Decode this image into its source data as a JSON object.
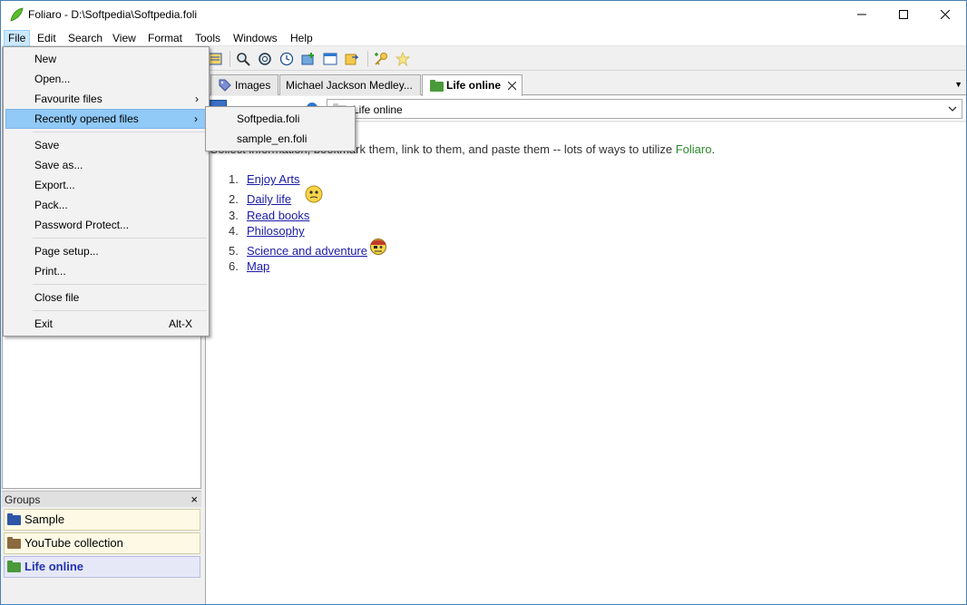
{
  "window": {
    "title": "Foliaro - D:\\Softpedia\\Softpedia.foli",
    "controls": {
      "minimize": "minimize-icon",
      "maximize": "maximize-icon",
      "close": "close-icon"
    }
  },
  "menubar": [
    "File",
    "Edit",
    "Search",
    "View",
    "Format",
    "Tools",
    "Windows",
    "Help"
  ],
  "file_menu": {
    "items": [
      {
        "label": "New"
      },
      {
        "label": "Open..."
      },
      {
        "label": "Favourite files",
        "submenu": true
      },
      {
        "label": "Recently opened files",
        "submenu": true,
        "highlighted": true
      },
      {
        "label": "Save"
      },
      {
        "label": "Save as..."
      },
      {
        "label": "Export..."
      },
      {
        "label": "Pack..."
      },
      {
        "label": "Password Protect..."
      },
      {
        "label": "Page setup..."
      },
      {
        "label": "Print..."
      },
      {
        "label": "Close file"
      },
      {
        "label": "Exit",
        "shortcut": "Alt-X"
      }
    ]
  },
  "recent_submenu": [
    "Softpedia.foli",
    "sample_en.foli"
  ],
  "tabs": [
    {
      "label": "Images",
      "active": false
    },
    {
      "label": "Michael Jackson Medley...",
      "active": false
    },
    {
      "label": "Life online",
      "active": true
    }
  ],
  "address": {
    "value": "Life online"
  },
  "content": {
    "intro": "Collect information, bookmark them, link to them, and paste them -- lots of ways to utilize ",
    "brand": "Foliaro",
    "brand_end": ".",
    "links": [
      {
        "num": "1.",
        "label": "Enjoy Arts"
      },
      {
        "num": "2.",
        "label": "Daily life"
      },
      {
        "num": "3.",
        "label": "Read books"
      },
      {
        "num": "4.",
        "label": "Philosophy"
      },
      {
        "num": "5.",
        "label": "Science and adventure "
      },
      {
        "num": "6.",
        "label": "Map"
      }
    ]
  },
  "groups": {
    "title": "Groups",
    "close": "×",
    "items": [
      {
        "label": "Sample",
        "folder_color": "#2f55a8",
        "selected": false
      },
      {
        "label": "YouTube collection",
        "folder_color": "#8a6a3e",
        "selected": false
      },
      {
        "label": "Life online",
        "folder_color": "#4a9a3a",
        "selected": true
      }
    ]
  },
  "colors": {
    "accent": "#cce8ff",
    "menu_highlight": "#91c9f7",
    "brand_green": "#2a8a2a"
  }
}
